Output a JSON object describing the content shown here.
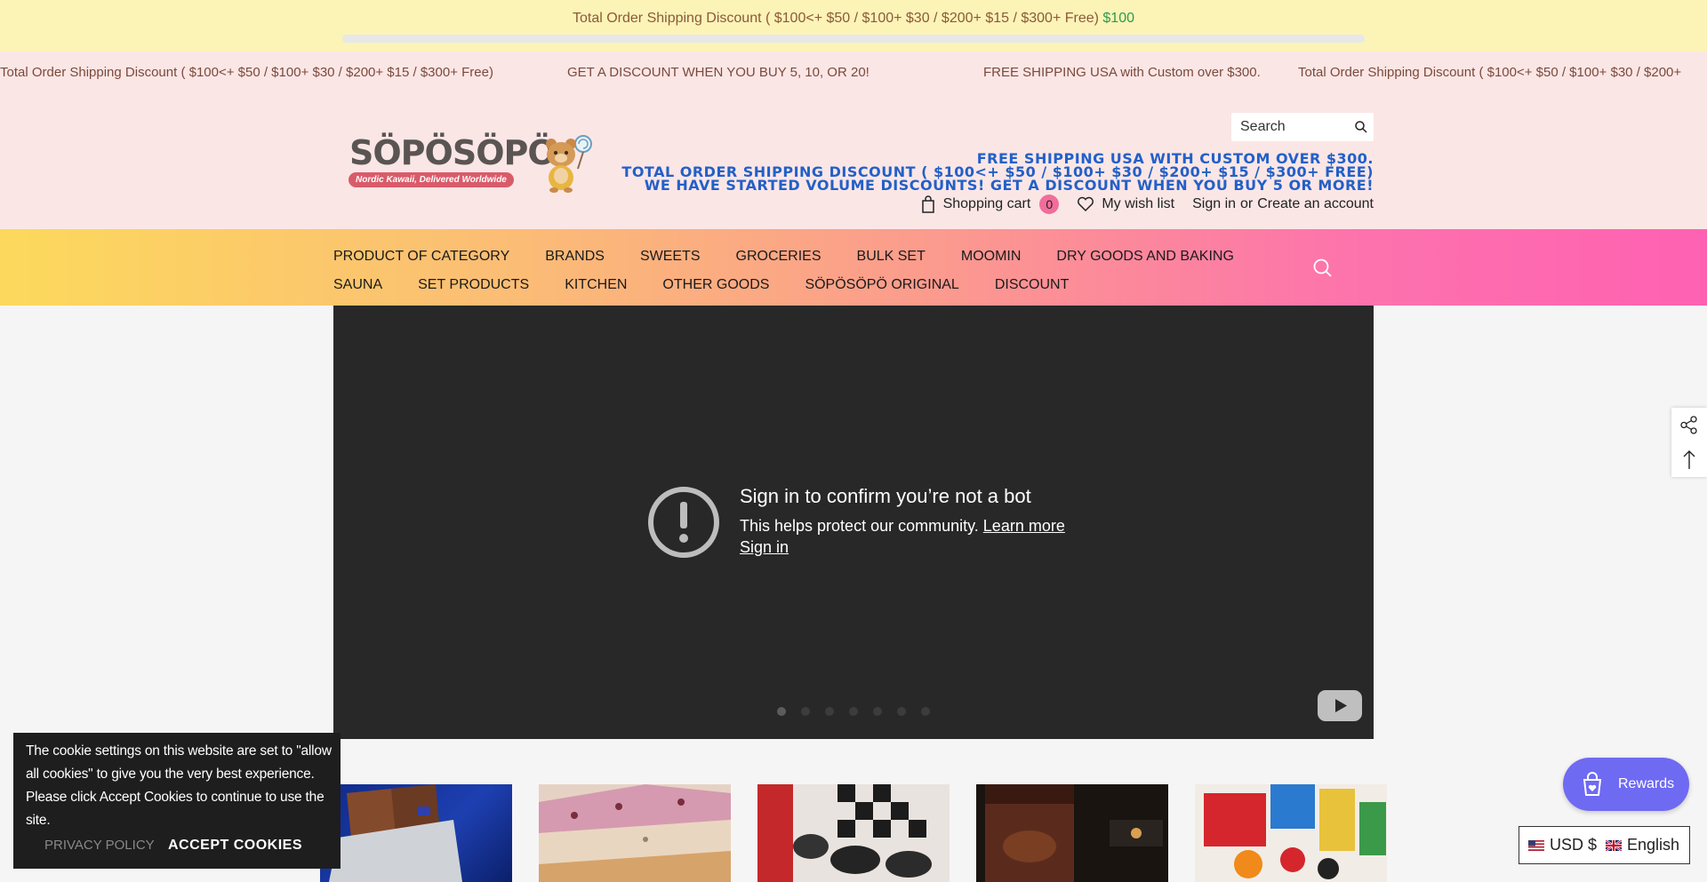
{
  "announcement": {
    "text": "Total Order Shipping Discount ( $100<+ $50 / $100+ $30 / $200+ $15 / $300+ Free)",
    "amount": "$100",
    "progress": 0
  },
  "marquee": [
    "Total Order Shipping Discount ( $100<+ $50 / $100+ $30 / $200+ $15 / $300+ Free)",
    "GET A DISCOUNT WHEN YOU BUY 5, 10, OR 20!",
    "FREE SHIPPING USA with Custom over $300.",
    "Total Order Shipping Discount ( $100<+ $50 / $100+ $30 / $200+"
  ],
  "header": {
    "logo_text": "SÖPÖSÖPÖ",
    "logo_tagline": "Nordic Kawaii, Delivered Worldwide",
    "search_placeholder": "Search",
    "promo_lines": [
      "FREE SHIPPING USA WITH CUSTOM OVER $300.",
      "TOTAL ORDER SHIPPING DISCOUNT ( $100<+ $50 / $100+ $30 / $200+ $15 / $300+ FREE)",
      "WE HAVE STARTED VOLUME DISCOUNTS! GET A DISCOUNT WHEN YOU BUY 5 OR MORE!"
    ],
    "cart_label": "Shopping cart",
    "cart_count": "0",
    "wishlist_label": "My wish list",
    "signin_label": "Sign in",
    "or_label": "or",
    "create_account_label": "Create an account"
  },
  "nav": {
    "row1": [
      "PRODUCT OF CATEGORY",
      "BRANDS",
      "SWEETS",
      "GROCERIES",
      "BULK SET",
      "MOOMIN",
      "DRY GOODS AND BAKING"
    ],
    "row2": [
      "SAUNA",
      "SET PRODUCTS",
      "KITCHEN",
      "OTHER GOODS",
      "SÖPÖSÖPÖ ORIGINAL",
      "DISCOUNT"
    ]
  },
  "video": {
    "title": "Sign in to confirm you’re not a bot",
    "line": "This helps protect our community.",
    "learn_more": "Learn more",
    "signin": "Sign in",
    "slide_count": 7,
    "active_slide": 1
  },
  "cookie": {
    "text": "The cookie settings on this website are set to \"allow all cookies\" to give you the very best experience. Please click Accept Cookies to continue to use the site.",
    "policy_label": "PRIVACY POLICY",
    "accept_label": "ACCEPT COOKIES"
  },
  "rewards": {
    "label": "Rewards"
  },
  "currency": {
    "currency_label": "USD $",
    "language_label": "English"
  },
  "colors": {
    "announce_bg": "#fcf3b7",
    "header_bg": "#fbe6e6",
    "promo_blue": "#2260c8",
    "cart_badge": "#f26d9c",
    "rewards_bg": "#6f6af2",
    "video_bg": "#282828"
  },
  "icons": [
    "search-icon",
    "cart-icon",
    "heart-icon",
    "share-icon",
    "arrow-up-icon",
    "youtube-icon",
    "warning-icon",
    "rewards-bag-icon",
    "us-flag-icon",
    "uk-flag-icon"
  ]
}
